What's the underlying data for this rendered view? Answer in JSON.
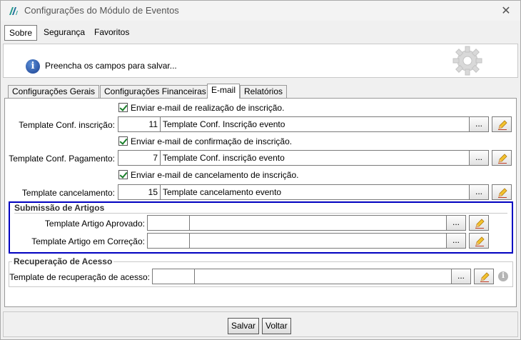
{
  "window": {
    "title": "Configurações do Módulo de Eventos",
    "close_glyph": "✕"
  },
  "menu": {
    "items": [
      "Sobre",
      "Segurança",
      "Favoritos"
    ]
  },
  "info": {
    "message": "Preencha os campos para salvar...",
    "glyph": "i"
  },
  "tabs": [
    "Configurações Gerais",
    "Configurações Financeiras",
    "E-mail",
    "Relatórios"
  ],
  "active_tab": "E-mail",
  "email_templates": [
    {
      "checkbox_label": "Enviar e-mail de realização de inscrição.",
      "checked": true,
      "label": "Template Conf. inscrição:",
      "id": "11",
      "name": "Template Conf. Inscrição evento"
    },
    {
      "checkbox_label": "Enviar e-mail de confirmação de inscrição.",
      "checked": true,
      "label": "Template Conf. Pagamento:",
      "id": "7",
      "name": "Template Conf. inscrição evento"
    },
    {
      "checkbox_label": "Enviar e-mail de cancelamento de inscrição.",
      "checked": true,
      "label": "Template cancelamento:",
      "id": "15",
      "name": "Template cancelamento evento"
    }
  ],
  "submissao": {
    "title": "Submissão de Artigos",
    "rows": [
      {
        "label": "Template Artigo Aprovado:",
        "id": "",
        "name": ""
      },
      {
        "label": "Template Artigo em Correção:",
        "id": "",
        "name": ""
      }
    ]
  },
  "recuperacao": {
    "title": "Recuperação de Acesso",
    "rows": [
      {
        "label": "Template de recuperação de acesso:",
        "id": "",
        "name": ""
      }
    ]
  },
  "lookup_button_label": "...",
  "help_glyph": "i",
  "footer": {
    "save": "Salvar",
    "back": "Voltar"
  },
  "colors": {
    "highlight_border": "#0000c0",
    "check": "#1a7f2a",
    "info_blue": "#1a3f8f"
  }
}
